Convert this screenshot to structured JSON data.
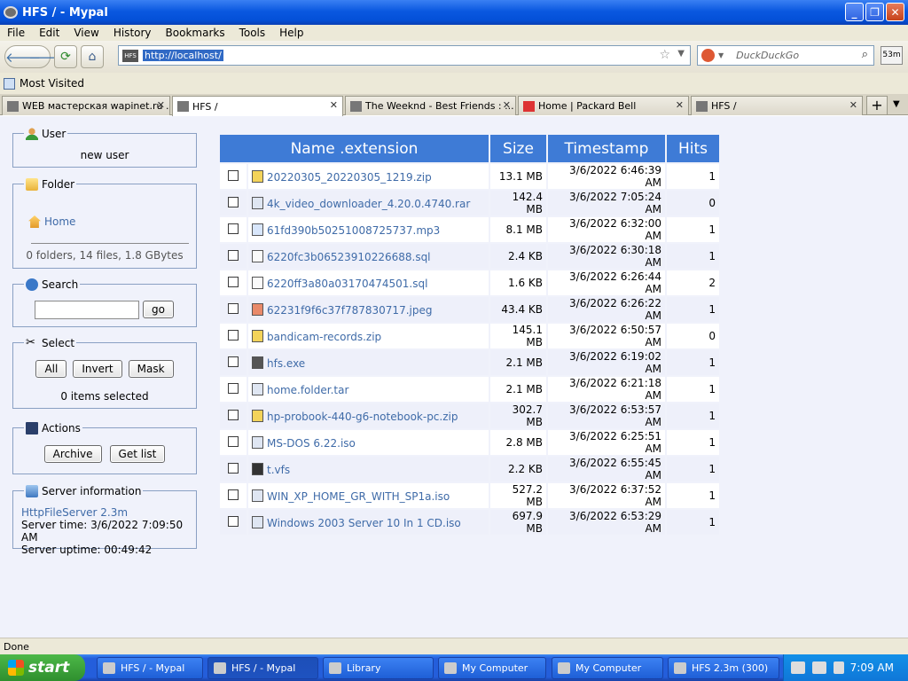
{
  "window": {
    "title": "HFS / - Mypal"
  },
  "menu": [
    "File",
    "Edit",
    "View",
    "History",
    "Bookmarks",
    "Tools",
    "Help"
  ],
  "nav": {
    "url": "http://localhost/",
    "site_badge": "HFS",
    "search_placeholder": "DuckDuckGo",
    "ext_badge": "53m"
  },
  "bookmarks": {
    "most_visited": "Most Visited"
  },
  "tabs": [
    {
      "label": "WEB мастерская wapinet.ru ..."
    },
    {
      "label": "HFS /"
    },
    {
      "label": "The Weeknd - Best Friends : ..."
    },
    {
      "label": "Home | Packard Bell"
    },
    {
      "label": "HFS /"
    }
  ],
  "sidebar": {
    "user": {
      "title": "User",
      "name": "new user"
    },
    "folder": {
      "title": "Folder",
      "home": "Home",
      "summary": "0 folders, 14 files, 1.8 GBytes"
    },
    "search": {
      "title": "Search",
      "go": "go"
    },
    "select": {
      "title": "Select",
      "all": "All",
      "invert": "Invert",
      "mask": "Mask",
      "count": "0 items selected"
    },
    "actions": {
      "title": "Actions",
      "archive": "Archive",
      "get_list": "Get list"
    },
    "server": {
      "title": "Server information",
      "software": "HttpFileServer 2.3m",
      "time": "Server time: 3/6/2022 7:09:50 AM",
      "uptime": "Server uptime: 00:49:42"
    }
  },
  "table": {
    "headers": {
      "name": "Name .extension",
      "size": "Size",
      "timestamp": "Timestamp",
      "hits": "Hits"
    },
    "rows": [
      {
        "name": "20220305_20220305_1219.zip",
        "size": "13.1 MB",
        "timestamp": "3/6/2022 6:46:39 AM",
        "hits": "1",
        "icon": "zip-icon"
      },
      {
        "name": "4k_video_downloader_4.20.0.4740.rar",
        "size": "142.4 MB",
        "timestamp": "3/6/2022 7:05:24 AM",
        "hits": "0",
        "icon": "archive-file-icon"
      },
      {
        "name": "61fd390b50251008725737.mp3",
        "size": "8.1 MB",
        "timestamp": "3/6/2022 6:32:00 AM",
        "hits": "1",
        "icon": "music-note-icon"
      },
      {
        "name": "6220fc3b06523910226688.sql",
        "size": "2.4 KB",
        "timestamp": "3/6/2022 6:30:18 AM",
        "hits": "1",
        "icon": "text-file-icon"
      },
      {
        "name": "6220ff3a80a03170474501.sql",
        "size": "1.6 KB",
        "timestamp": "3/6/2022 6:26:44 AM",
        "hits": "2",
        "icon": "text-file-icon"
      },
      {
        "name": "62231f9f6c37f787830717.jpeg",
        "size": "43.4 KB",
        "timestamp": "3/6/2022 6:26:22 AM",
        "hits": "1",
        "icon": "image-file-icon"
      },
      {
        "name": "bandicam-records.zip",
        "size": "145.1 MB",
        "timestamp": "3/6/2022 6:50:57 AM",
        "hits": "0",
        "icon": "zip-icon"
      },
      {
        "name": "hfs.exe",
        "size": "2.1 MB",
        "timestamp": "3/6/2022 6:19:02 AM",
        "hits": "1",
        "icon": "hfs-app-icon"
      },
      {
        "name": "home.folder.tar",
        "size": "2.1 MB",
        "timestamp": "3/6/2022 6:21:18 AM",
        "hits": "1",
        "icon": "archive-file-icon"
      },
      {
        "name": "hp-probook-440-g6-notebook-pc.zip",
        "size": "302.7 MB",
        "timestamp": "3/6/2022 6:53:57 AM",
        "hits": "1",
        "icon": "zip-icon"
      },
      {
        "name": "MS-DOS 6.22.iso",
        "size": "2.8 MB",
        "timestamp": "3/6/2022 6:25:51 AM",
        "hits": "1",
        "icon": "archive-file-icon"
      },
      {
        "name": "t.vfs",
        "size": "2.2 KB",
        "timestamp": "3/6/2022 6:55:45 AM",
        "hits": "1",
        "icon": "vfs-file-icon"
      },
      {
        "name": "WIN_XP_HOME_GR_WITH_SP1a.iso",
        "size": "527.2 MB",
        "timestamp": "3/6/2022 6:37:52 AM",
        "hits": "1",
        "icon": "archive-file-icon"
      },
      {
        "name": "Windows 2003 Server 10 In 1 CD.iso",
        "size": "697.9 MB",
        "timestamp": "3/6/2022 6:53:29 AM",
        "hits": "1",
        "icon": "archive-file-icon"
      }
    ]
  },
  "status": {
    "text": "Done"
  },
  "taskbar": {
    "start": "start",
    "items": [
      "HFS / - Mypal",
      "HFS / - Mypal",
      "Library",
      "My Computer",
      "My Computer",
      "HFS 2.3m (300)"
    ],
    "clock": "7:09 AM"
  }
}
